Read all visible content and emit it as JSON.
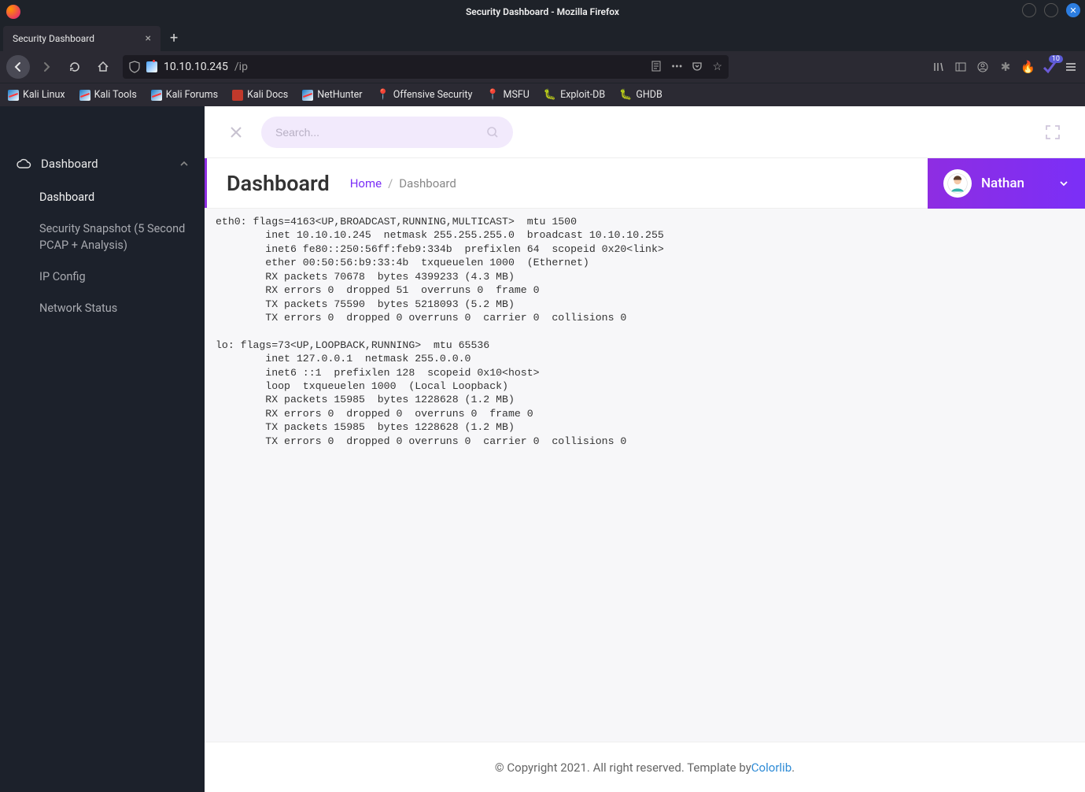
{
  "firefox": {
    "window_title": "Security Dashboard - Mozilla Firefox",
    "tab_label": "Security Dashboard",
    "url_host": "10.10.10.245",
    "url_path": "/ip",
    "ext_badge": "10"
  },
  "bookmarks": [
    {
      "label": "Kali Linux"
    },
    {
      "label": "Kali Tools"
    },
    {
      "label": "Kali Forums"
    },
    {
      "label": "Kali Docs"
    },
    {
      "label": "NetHunter"
    },
    {
      "label": "Offensive Security"
    },
    {
      "label": "MSFU"
    },
    {
      "label": "Exploit-DB"
    },
    {
      "label": "GHDB"
    }
  ],
  "sidebar": {
    "group": "Dashboard",
    "items": [
      {
        "label": "Dashboard"
      },
      {
        "label": "Security Snapshot (5 Second PCAP + Analysis)"
      },
      {
        "label": "IP Config"
      },
      {
        "label": "Network Status"
      }
    ]
  },
  "search": {
    "placeholder": "Search..."
  },
  "header": {
    "title": "Dashboard",
    "home": "Home",
    "sep": "/",
    "current": "Dashboard"
  },
  "user": {
    "name": "Nathan"
  },
  "ifconfig": "eth0: flags=4163<UP,BROADCAST,RUNNING,MULTICAST>  mtu 1500\n        inet 10.10.10.245  netmask 255.255.255.0  broadcast 10.10.10.255\n        inet6 fe80::250:56ff:feb9:334b  prefixlen 64  scopeid 0x20<link>\n        ether 00:50:56:b9:33:4b  txqueuelen 1000  (Ethernet)\n        RX packets 70678  bytes 4399233 (4.3 MB)\n        RX errors 0  dropped 51  overruns 0  frame 0\n        TX packets 75590  bytes 5218093 (5.2 MB)\n        TX errors 0  dropped 0 overruns 0  carrier 0  collisions 0\n\nlo: flags=73<UP,LOOPBACK,RUNNING>  mtu 65536\n        inet 127.0.0.1  netmask 255.0.0.0\n        inet6 ::1  prefixlen 128  scopeid 0x10<host>\n        loop  txqueuelen 1000  (Local Loopback)\n        RX packets 15985  bytes 1228628 (1.2 MB)\n        RX errors 0  dropped 0  overruns 0  frame 0\n        TX packets 15985  bytes 1228628 (1.2 MB)\n        TX errors 0  dropped 0 overruns 0  carrier 0  collisions 0\n",
  "footer": {
    "text": "© Copyright 2021. All right reserved. Template by ",
    "link": "Colorlib",
    "dot": "."
  }
}
